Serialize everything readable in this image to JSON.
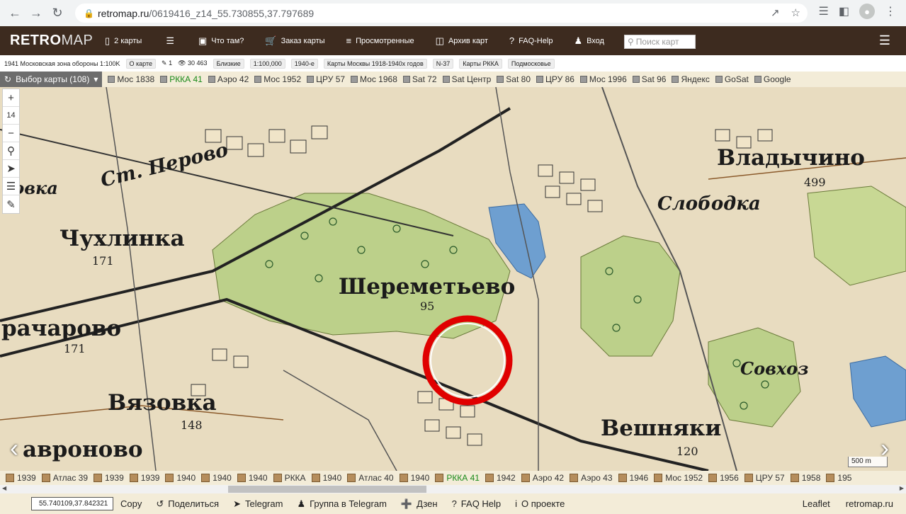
{
  "browser": {
    "url_host": "retromap.ru",
    "url_path": "/0619416_z14_55.730855,37.797689"
  },
  "header": {
    "logo_retro": "RETRO",
    "logo_map": "MAP",
    "nav": [
      {
        "label": "2 карты",
        "icon": "two-maps-icon"
      },
      {
        "label": "",
        "icon": "layers-icon"
      },
      {
        "label": "Что там?",
        "icon": "image-icon"
      },
      {
        "label": "Заказ карты",
        "icon": "cart-icon"
      },
      {
        "label": "Просмотренные",
        "icon": "list-icon"
      },
      {
        "label": "Архив карт",
        "icon": "database-icon"
      },
      {
        "label": "FAQ-Help",
        "icon": "question-icon"
      },
      {
        "label": "Вход",
        "icon": "user-plus-icon"
      }
    ],
    "search_placeholder": "Поиск карт"
  },
  "info_bar": {
    "title": "1941 Московская зона обороны 1:100K",
    "about_label": "О карте",
    "comments": "1",
    "views": "30 463",
    "tags": [
      "Близкие",
      "1:100,000",
      "1940-е",
      "Карты Москвы 1918-1940х годов",
      "N-37",
      "Карты РККА",
      "Подмосковье"
    ]
  },
  "layer_bar": {
    "select_label": "Выбор карты (108)",
    "items": [
      {
        "label": "Мос 1838",
        "active": false
      },
      {
        "label": "РККА 41",
        "active": true
      },
      {
        "label": "Аэро 42",
        "active": false
      },
      {
        "label": "Мос 1952",
        "active": false
      },
      {
        "label": "ЦРУ 57",
        "active": false
      },
      {
        "label": "Мос 1968",
        "active": false
      },
      {
        "label": "Sat 72",
        "active": false
      },
      {
        "label": "Sat Центр",
        "active": false
      },
      {
        "label": "Sat 80",
        "active": false
      },
      {
        "label": "ЦРУ 86",
        "active": false
      },
      {
        "label": "Мос 1996",
        "active": false
      },
      {
        "label": "Sat 96",
        "active": false
      },
      {
        "label": "Яндекс",
        "active": false
      },
      {
        "label": "GoSat",
        "active": false
      },
      {
        "label": "Google",
        "active": false
      }
    ]
  },
  "map": {
    "zoom_level": "14",
    "scale_label": "500 m",
    "labels": {
      "vladychino": "Владычино",
      "vladychino_num": "499",
      "slobodka": "Слободка",
      "chukhlinka": "Чухлинка",
      "chukhlinka_num": "171",
      "st_perovo": "Ст. Перово",
      "sheremetyevo": "Шереметьево",
      "sheremetyevo_num": "95",
      "gracharovo": "рачарово",
      "gracharovo_num": "171",
      "vyazovka": "Вязовка",
      "vyazovka_num": "148",
      "avronovo": "авроново",
      "veshnyaki": "Вешняки",
      "veshnyaki_num": "120",
      "sovkhoz": "Совхоз",
      "kovki": "ковка"
    },
    "colors": {
      "paper": "#e8dcc0",
      "forest": "#bcd08a",
      "water": "#6e9fd0",
      "marker": "#e00000"
    }
  },
  "bottom_strip": [
    {
      "label": "1939",
      "active": false
    },
    {
      "label": "Атлас 39",
      "active": false
    },
    {
      "label": "1939",
      "active": false
    },
    {
      "label": "1939",
      "active": false
    },
    {
      "label": "1940",
      "active": false
    },
    {
      "label": "1940",
      "active": false
    },
    {
      "label": "1940",
      "active": false
    },
    {
      "label": "РККА",
      "active": false
    },
    {
      "label": "1940",
      "active": false
    },
    {
      "label": "Атлас 40",
      "active": false
    },
    {
      "label": "1940",
      "active": false
    },
    {
      "label": "РККА 41",
      "active": true
    },
    {
      "label": "1942",
      "active": false
    },
    {
      "label": "Аэро 42",
      "active": false
    },
    {
      "label": "Аэро 43",
      "active": false
    },
    {
      "label": "1946",
      "active": false
    },
    {
      "label": "Мос 1952",
      "active": false
    },
    {
      "label": "1956",
      "active": false
    },
    {
      "label": "ЦРУ 57",
      "active": false
    },
    {
      "label": "1958",
      "active": false
    },
    {
      "label": "195",
      "active": false
    }
  ],
  "footer": {
    "coords": "55.740109,37.842321",
    "copy": "Copy",
    "share": "Поделиться",
    "telegram": "Telegram",
    "telegram_group": "Группа в Telegram",
    "dzen": "Дзен",
    "faq": "FAQ Help",
    "about": "О проекте",
    "leaflet": "Leaflet",
    "site": "retromap.ru"
  }
}
